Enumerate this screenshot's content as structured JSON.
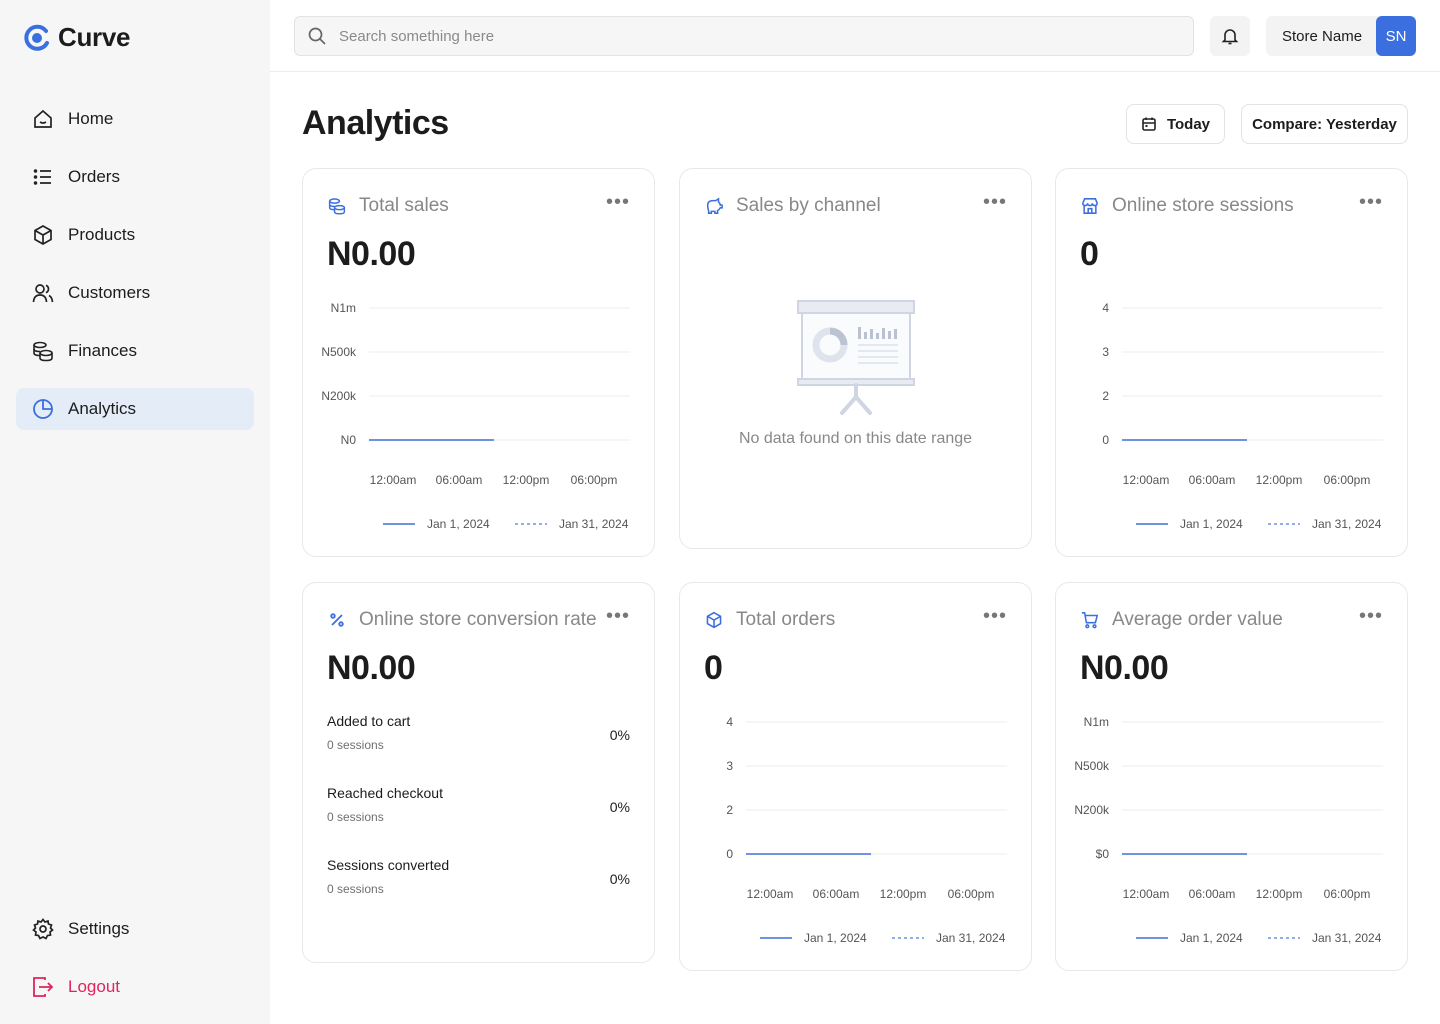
{
  "app": {
    "name": "Curve"
  },
  "sidebar": {
    "items": [
      {
        "label": "Home",
        "icon": "home-icon"
      },
      {
        "label": "Orders",
        "icon": "list-icon"
      },
      {
        "label": "Products",
        "icon": "box-icon"
      },
      {
        "label": "Customers",
        "icon": "users-icon"
      },
      {
        "label": "Finances",
        "icon": "coins-icon"
      },
      {
        "label": "Analytics",
        "icon": "pie-chart-icon",
        "active": true
      }
    ],
    "bottom": [
      {
        "label": "Settings",
        "icon": "gear-icon"
      },
      {
        "label": "Logout",
        "icon": "logout-icon"
      }
    ]
  },
  "topbar": {
    "search_placeholder": "Search something here",
    "store_name": "Store Name",
    "avatar_initials": "SN"
  },
  "header": {
    "title": "Analytics",
    "today_label": "Today",
    "compare_label": "Compare: Yesterday"
  },
  "colors": {
    "accent": "#3b6fe0",
    "active_nav_bg": "#e4ecf8",
    "logout": "#e0245e",
    "series": "#6f93e0"
  },
  "cards": {
    "total_sales": {
      "title": "Total sales",
      "value": "N0.00"
    },
    "sales_by_channel": {
      "title": "Sales by channel",
      "empty_text": "No data found on this date range"
    },
    "online_sessions": {
      "title": "Online store sessions",
      "value": "0"
    },
    "conversion": {
      "title": "Online store conversion rate",
      "value": "N0.00",
      "rows": [
        {
          "label": "Added to cart",
          "sub": "0 sessions",
          "pct": "0%"
        },
        {
          "label": "Reached checkout",
          "sub": "0 sessions",
          "pct": "0%"
        },
        {
          "label": "Sessions converted",
          "sub": "0 sessions",
          "pct": "0%"
        }
      ]
    },
    "total_orders": {
      "title": "Total orders",
      "value": "0"
    },
    "avg_order_value": {
      "title": "Average order value",
      "value": "N0.00"
    }
  },
  "chart_data": [
    {
      "id": "total_sales",
      "type": "line",
      "y_ticks": [
        "N1m",
        "N500k",
        "N200k",
        "N0"
      ],
      "x_ticks": [
        "12:00am",
        "06:00am",
        "12:00pm",
        "06:00pm"
      ],
      "series": [
        {
          "name": "Jan 1, 2024",
          "style": "solid",
          "values": [
            0,
            0
          ]
        },
        {
          "name": "Jan 31, 2024",
          "style": "dashed",
          "values": []
        }
      ]
    },
    {
      "id": "online_sessions",
      "type": "line",
      "y_ticks": [
        "4",
        "3",
        "2",
        "0"
      ],
      "x_ticks": [
        "12:00am",
        "06:00am",
        "12:00pm",
        "06:00pm"
      ],
      "series": [
        {
          "name": "Jan 1, 2024",
          "style": "solid",
          "values": [
            0,
            0
          ]
        },
        {
          "name": "Jan 31, 2024",
          "style": "dashed",
          "values": []
        }
      ]
    },
    {
      "id": "total_orders",
      "type": "line",
      "y_ticks": [
        "4",
        "3",
        "2",
        "0"
      ],
      "x_ticks": [
        "12:00am",
        "06:00am",
        "12:00pm",
        "06:00pm"
      ],
      "series": [
        {
          "name": "Jan 1, 2024",
          "style": "solid",
          "values": [
            0,
            0
          ]
        },
        {
          "name": "Jan 31, 2024",
          "style": "dashed",
          "values": []
        }
      ]
    },
    {
      "id": "avg_order_value",
      "type": "line",
      "y_ticks": [
        "N1m",
        "N500k",
        "N200k",
        "$0"
      ],
      "x_ticks": [
        "12:00am",
        "06:00am",
        "12:00pm",
        "06:00pm"
      ],
      "series": [
        {
          "name": "Jan 1, 2024",
          "style": "solid",
          "values": [
            0,
            0
          ]
        },
        {
          "name": "Jan 31, 2024",
          "style": "dashed",
          "values": []
        }
      ]
    }
  ]
}
